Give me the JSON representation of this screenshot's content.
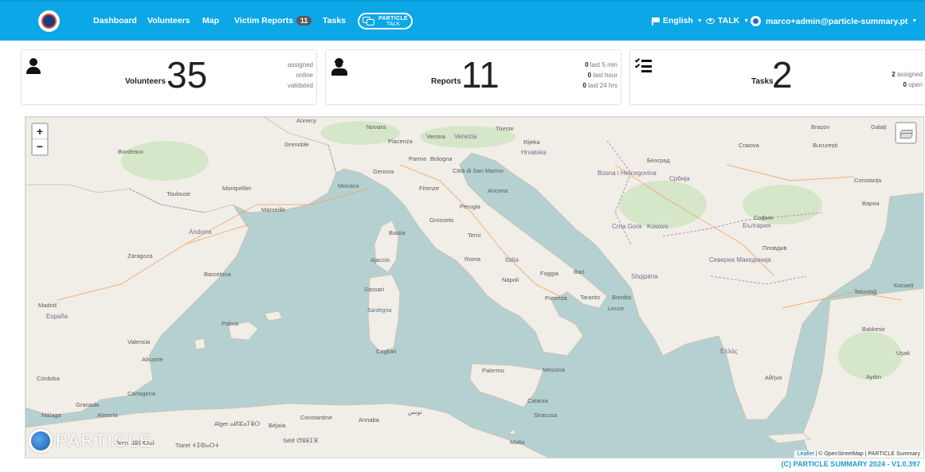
{
  "navbar": {
    "items": [
      {
        "label": "Dashboard"
      },
      {
        "label": "Volunteers"
      },
      {
        "label": "Map"
      },
      {
        "label": "Victim Reports",
        "badge": "11"
      },
      {
        "label": "Tasks"
      }
    ],
    "talk_logo": {
      "line1": "PARTICLE",
      "line2": "TALK"
    },
    "language": "English",
    "talk_menu": "TALK",
    "user_email": "marco+admin@particle-summary.pt",
    "brand_color": "#0ba7e6"
  },
  "cards": {
    "volunteers": {
      "label": "Volunteers",
      "count": "35",
      "side": [
        "assigned",
        "online",
        "validated"
      ]
    },
    "reports": {
      "label": "Reports",
      "count": "11",
      "side": [
        {
          "value": "0",
          "text": "last 5 min"
        },
        {
          "value": "0",
          "text": "last hour"
        },
        {
          "value": "0",
          "text": "last 24 hrs"
        }
      ]
    },
    "tasks": {
      "label": "Tasks",
      "count": "2",
      "side": [
        {
          "value": "2",
          "text": "assigned"
        },
        {
          "value": "0",
          "text": "open"
        }
      ]
    }
  },
  "map": {
    "zoom_in": "+",
    "zoom_out": "−",
    "watermark": "PARTICLE",
    "attribution_leaflet": "Leaflet",
    "attribution_rest": " | © OpenStreetMap | PARTICLE Summary",
    "labels": {
      "bordeaux": "Bordeaux",
      "toulouse": "Toulouse",
      "montpellier": "Montpellier",
      "marseille": "Marseille",
      "monaco": "Monaco",
      "grenoble": "Grenoble",
      "annecy": "Annecy",
      "novara": "Novara",
      "piacenza": "Piacenza",
      "verona": "Verona",
      "venezia": "Venezia",
      "trieste": "Trieste",
      "rijeka": "Rijeka",
      "genova": "Genova",
      "bologna": "Bologna",
      "parma": "Parma",
      "firenze": "Firenze",
      "san_marino": "Città di San Marino",
      "ancona": "Ancona",
      "perugia": "Perugia",
      "grosseto": "Grosseto",
      "roma": "Roma",
      "italia": "Italia",
      "terni": "Terni",
      "bastia": "Bastia",
      "ajaccio": "Ajaccio",
      "sassari": "Sassari",
      "sardegna": "Sardegna",
      "cagliari": "Cagliari",
      "napoli": "Napoli",
      "bari": "Bari",
      "foggia": "Foggia",
      "potenza": "Potenza",
      "taranto": "Taranto",
      "brindisi": "Brindisi",
      "lecce": "Lecce",
      "palermo": "Palermo",
      "messina": "Messina",
      "catania": "Catania",
      "siracusa": "Siracusa",
      "malta": "Malta",
      "zagreb": "Hrvatska",
      "bosna": "Bosna i Hercegovina",
      "srbija": "Србија",
      "beograd": "Београд",
      "crna_gora": "Crna Gora",
      "kosovo": "Kosovo",
      "shqiperia": "Shqipëria",
      "severna": "Северна Македонија",
      "bulgaria": "България",
      "sofia": "София",
      "plovdiv": "Пловдив",
      "bucuresti": "București",
      "craiova": "Craiova",
      "constanta": "Constanța",
      "varna": "Варна",
      "brasov": "Brașov",
      "galati": "Galați",
      "ellas": "Ελλάς",
      "athina": "Αθήνα",
      "tekirdag": "Tekirdağ",
      "kocaeli": "Kocaeli",
      "balikesir": "Balıkesir",
      "aydin": "Aydın",
      "usak": "Uşak",
      "madrid": "Madrid",
      "espana": "España",
      "zaragoza": "Zaragoza",
      "barcelona": "Barcelona",
      "valencia": "Valencia",
      "alicante": "Alicante",
      "palma": "Palma",
      "andorra": "Andorra",
      "granada": "Granada",
      "malaga": "Málaga",
      "cordoba": "Córdoba",
      "almeria": "Almería",
      "cartagena": "Cartagena",
      "alger": "Alger ⴰⵍⵣⴰⵢⴻⵔ",
      "tunis": "تونس",
      "constantine": "Constantine",
      "setif": "Sétif ⵚⴻⵟⵉⴼ",
      "oran": "Oran ⵡⴻⵀⵔⴰⵏ",
      "tiaret": "Tiaret ⵜⵉⵀⴰⵔⵜ",
      "bejaia": "Béjaïa",
      "annaba": "Annaba"
    }
  },
  "footer": "(C) PARTICLE SUMMARY 2024 - V1.0.397"
}
